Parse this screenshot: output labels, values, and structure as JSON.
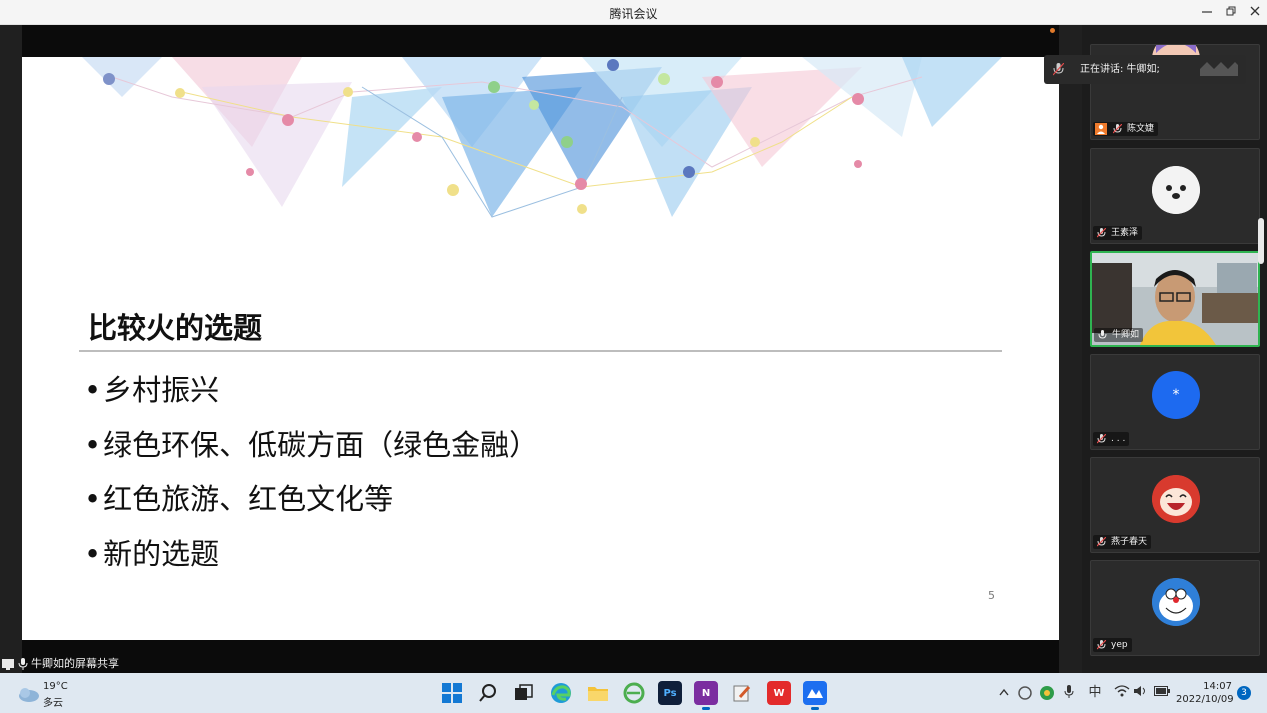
{
  "window": {
    "title": "腾讯会议"
  },
  "slide": {
    "title": "比较火的选题",
    "bullets": [
      "乡村振兴",
      "绿色环保、低碳方面（绿色金融）",
      "红色旅游、红色文化等",
      "新的选题"
    ],
    "page_number": "5"
  },
  "speaking": {
    "label": "正在讲话: 牛卿如;"
  },
  "participants": [
    {
      "name": "陈文婕"
    },
    {
      "name": "王素泽"
    },
    {
      "name": "牛卿如"
    },
    {
      "name": ". . .",
      "avatar_text": "*"
    },
    {
      "name": "燕子春天"
    },
    {
      "name": "yep"
    }
  ],
  "share_bar": {
    "label": "牛卿如的屏幕共享"
  },
  "taskbar": {
    "weather": {
      "temp": "19°C",
      "condition": "多云"
    },
    "ime": "中",
    "time": "14:07",
    "date": "2022/10/09",
    "notifications": "3",
    "apps": [
      "start",
      "search",
      "task-view",
      "edge",
      "file-explorer",
      "ie",
      "photoshop",
      "onenote",
      "paint",
      "wps",
      "tencent-meeting"
    ]
  },
  "colors": {
    "active_border": "#2fb451",
    "taskbar": "#dfe8f1",
    "accent": "#0067c0"
  }
}
